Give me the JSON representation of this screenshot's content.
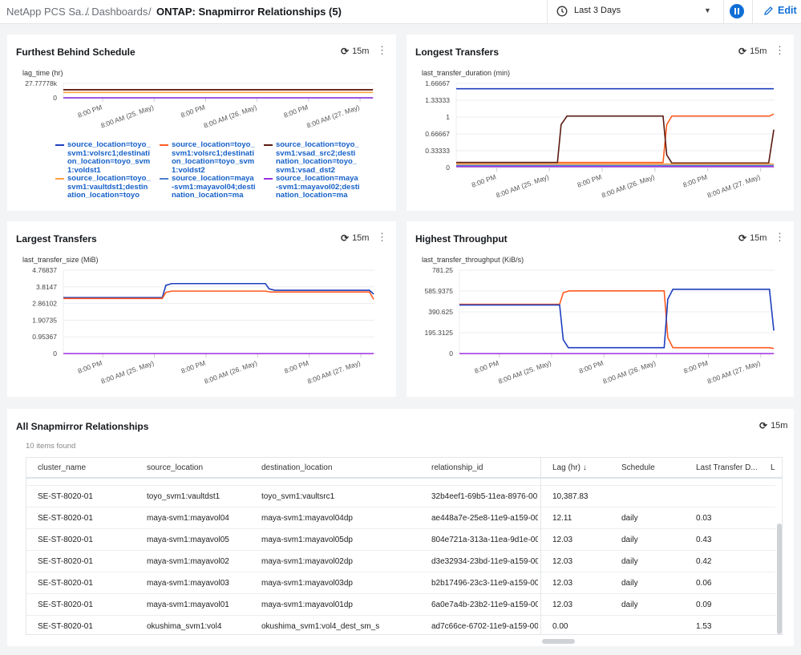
{
  "header": {
    "crumb_root": "NetApp PCS Sa...",
    "crumb_dashboards": "/ Dashboards",
    "sep": "/",
    "title": "ONTAP: Snapmirror Relationships (5)",
    "time_range": "Last 3 Days",
    "edit": "Edit",
    "accent": "#0f6fd6"
  },
  "x_axis": {
    "range": [
      "05-24 10:50",
      "05-27 11:10"
    ],
    "ticks": [
      {
        "t": "05-24 20:00",
        "label": "8:00 PM"
      },
      {
        "t": "05-25 08:00",
        "label": "8:00 AM (25. May)"
      },
      {
        "t": "05-25 20:00",
        "label": "8:00 PM"
      },
      {
        "t": "05-26 08:00",
        "label": "8:00 AM (26. May)"
      },
      {
        "t": "05-26 20:00",
        "label": "8:00 PM"
      },
      {
        "t": "05-27 08:00",
        "label": "8:00 AM (27. May)"
      }
    ]
  },
  "chart_data": [
    {
      "type": "line",
      "title": "Furthest Behind Schedule",
      "refresh": "15m",
      "ylabel": "lag_time (hr)",
      "ylim": [
        0,
        27777.78
      ],
      "y_ticks": [
        "0",
        "27.77778k"
      ],
      "y_tick_values": [
        0,
        27777.78
      ],
      "grid": true,
      "series": [
        {
          "name": "source_location=toyo_svm1:volsrc1;destination_location=toyo_svm1:voldst1",
          "color": "#1f3fbf",
          "points": [
            [
              "05-24 10:50",
              15700
            ],
            [
              "05-27 11:00",
              15700
            ]
          ]
        },
        {
          "name": "source_location=toyo_svm1:volsrc1;destination_location=toyo_svm1:voldst2",
          "color": "#ff5a1f",
          "points": [
            [
              "05-24 10:50",
              15500
            ],
            [
              "05-27 11:00",
              15500
            ]
          ]
        },
        {
          "name": "source_location=toyo_svm1:vsad_src2;destination_location=toyo_svm1:vsad_dst2",
          "color": "#5a1a10",
          "points": [
            [
              "05-24 10:50",
              15600
            ],
            [
              "05-27 11:00",
              15600
            ]
          ]
        },
        {
          "name": "source_location=toyo_svm1:vaultdst1;destination_location=toyo",
          "color": "#ffa040",
          "points": [
            [
              "05-24 10:50",
              10390
            ],
            [
              "05-27 11:00",
              10390
            ]
          ]
        },
        {
          "name": "source_location=maya-svm1:mayavol04;destination_location=ma",
          "color": "#4a7fd0",
          "points": [
            [
              "05-24 10:50",
              12
            ],
            [
              "05-27 11:00",
              12
            ]
          ]
        },
        {
          "name": "source_location=maya-svm1:mayavol02;destination_location=ma",
          "color": "#9b30e0",
          "points": [
            [
              "05-24 10:50",
              12
            ],
            [
              "05-27 11:00",
              12
            ]
          ]
        }
      ]
    },
    {
      "type": "line",
      "title": "Longest Transfers",
      "refresh": "15m",
      "ylabel": "last_transfer_duration (min)",
      "ylim": [
        0,
        1.66667
      ],
      "y_ticks": [
        "0",
        "0.33333",
        "0.66667",
        "1",
        "1.33333",
        "1.66667"
      ],
      "y_tick_values": [
        0,
        0.33333,
        0.66667,
        1,
        1.33333,
        1.66667
      ],
      "grid": true,
      "series": [
        {
          "color": "#1f3fbf",
          "points": [
            [
              "05-24 10:50",
              1.56
            ],
            [
              "05-27 11:00",
              1.56
            ]
          ]
        },
        {
          "color": "#ff5a1f",
          "points": [
            [
              "05-24 10:50",
              0.1
            ],
            [
              "05-26 09:50",
              0.1
            ],
            [
              "05-26 10:40",
              0.85
            ],
            [
              "05-26 11:50",
              1.02
            ],
            [
              "05-27 10:00",
              1.02
            ],
            [
              "05-27 11:00",
              1.06
            ]
          ]
        },
        {
          "color": "#5a1a10",
          "points": [
            [
              "05-24 10:50",
              0.1
            ],
            [
              "05-25 09:50",
              0.1
            ],
            [
              "05-25 10:40",
              0.85
            ],
            [
              "05-25 12:00",
              1.02
            ],
            [
              "05-26 09:50",
              1.02
            ],
            [
              "05-26 10:40",
              0.25
            ],
            [
              "05-26 11:50",
              0.09
            ],
            [
              "05-27 09:50",
              0.09
            ],
            [
              "05-27 11:00",
              0.75
            ]
          ]
        },
        {
          "color": "#ffa040",
          "points": [
            [
              "05-24 10:50",
              0.07
            ],
            [
              "05-27 11:00",
              0.07
            ]
          ]
        },
        {
          "color": "#4a7fd0",
          "points": [
            [
              "05-24 10:50",
              0.04
            ],
            [
              "05-27 11:00",
              0.04
            ]
          ]
        },
        {
          "color": "#9b30e0",
          "points": [
            [
              "05-24 10:50",
              0.02
            ],
            [
              "05-27 11:00",
              0.02
            ]
          ]
        }
      ]
    },
    {
      "type": "line",
      "title": "Largest Transfers",
      "refresh": "15m",
      "ylabel": "last_transfer_size (MiB)",
      "ylim": [
        0,
        4.76837
      ],
      "y_ticks": [
        "0",
        "0.95367",
        "1.90735",
        "2.86102",
        "3.8147",
        "4.76837"
      ],
      "y_tick_values": [
        0,
        0.95367,
        1.90735,
        2.86102,
        3.8147,
        4.76837
      ],
      "grid": true,
      "series": [
        {
          "color": "#9b30e0",
          "points": [
            [
              "05-24 10:50",
              0
            ],
            [
              "05-27 11:00",
              0
            ]
          ]
        },
        {
          "color": "#1f3fbf",
          "points": [
            [
              "05-24 10:50",
              3.2
            ],
            [
              "05-25 09:50",
              3.2
            ],
            [
              "05-25 10:40",
              3.9
            ],
            [
              "05-25 12:00",
              4.0
            ],
            [
              "05-26 09:50",
              4.0
            ],
            [
              "05-26 10:40",
              3.7
            ],
            [
              "05-26 12:00",
              3.62
            ],
            [
              "05-27 10:00",
              3.62
            ],
            [
              "05-27 11:00",
              3.4
            ]
          ]
        },
        {
          "color": "#ff5a1f",
          "points": [
            [
              "05-24 10:50",
              3.15
            ],
            [
              "05-25 09:50",
              3.15
            ],
            [
              "05-25 10:40",
              3.5
            ],
            [
              "05-25 12:00",
              3.57
            ],
            [
              "05-26 09:50",
              3.57
            ],
            [
              "05-26 11:00",
              3.52
            ],
            [
              "05-27 10:00",
              3.52
            ],
            [
              "05-27 11:00",
              3.1
            ]
          ]
        }
      ]
    },
    {
      "type": "line",
      "title": "Highest Throughput",
      "refresh": "15m",
      "ylabel": "last_transfer_throughput (KiB/s)",
      "ylim": [
        0,
        781.25
      ],
      "y_ticks": [
        "0",
        "195.3125",
        "390.625",
        "585.9375",
        "781.25"
      ],
      "y_tick_values": [
        0,
        195.3125,
        390.625,
        585.9375,
        781.25
      ],
      "grid": true,
      "series": [
        {
          "color": "#9b30e0",
          "points": [
            [
              "05-24 10:50",
              0
            ],
            [
              "05-27 11:00",
              0
            ]
          ]
        },
        {
          "color": "#ff5a1f",
          "points": [
            [
              "05-24 10:50",
              462
            ],
            [
              "05-25 09:50",
              462
            ],
            [
              "05-25 10:40",
              570
            ],
            [
              "05-25 12:00",
              587
            ],
            [
              "05-26 09:50",
              587
            ],
            [
              "05-26 10:40",
              150
            ],
            [
              "05-26 11:50",
              55
            ],
            [
              "05-27 10:00",
              55
            ],
            [
              "05-27 11:00",
              48
            ]
          ]
        },
        {
          "color": "#1f3fbf",
          "points": [
            [
              "05-24 10:50",
              455
            ],
            [
              "05-25 09:50",
              455
            ],
            [
              "05-25 10:40",
              130
            ],
            [
              "05-25 11:50",
              55
            ],
            [
              "05-26 09:50",
              55
            ],
            [
              "05-26 10:40",
              510
            ],
            [
              "05-26 11:50",
              602
            ],
            [
              "05-27 10:00",
              602
            ],
            [
              "05-27 11:00",
              215
            ]
          ]
        }
      ]
    }
  ],
  "table": {
    "title": "All Snapmirror Relationships",
    "refresh": "15m",
    "count": "10 items found",
    "columns": [
      "cluster_name",
      "source_location",
      "destination_location",
      "relationship_id",
      "Lag (hr) ↓",
      "Schedule",
      "Last Transfer D...",
      "L"
    ],
    "rows": [
      [
        "SE-ST-8020-01",
        "toyo_svm1:vaultdst1",
        "toyo_svm1:vaultsrc1",
        "32b4eef1-69b5-11ea-8976-00",
        "10,387.83",
        "",
        ""
      ],
      [
        "SE-ST-8020-01",
        "maya-svm1:mayavol04",
        "maya-svm1:mayavol04dp",
        "ae448a7e-25e8-11e9-a159-00",
        "12.11",
        "daily",
        "0.03"
      ],
      [
        "SE-ST-8020-01",
        "maya-svm1:mayavol05",
        "maya-svm1:mayavol05dp",
        "804e721a-313a-11ea-9d1e-00",
        "12.03",
        "daily",
        "0.43"
      ],
      [
        "SE-ST-8020-01",
        "maya-svm1:mayavol02",
        "maya-svm1:mayavol02dp",
        "d3e32934-23bd-11e9-a159-00",
        "12.03",
        "daily",
        "0.42"
      ],
      [
        "SE-ST-8020-01",
        "maya-svm1:mayavol03",
        "maya-svm1:mayavol03dp",
        "b2b17496-23c3-11e9-a159-00",
        "12.03",
        "daily",
        "0.06"
      ],
      [
        "SE-ST-8020-01",
        "maya-svm1:mayavol01",
        "maya-svm1:mayavol01dp",
        "6a0e7a4b-23b2-11e9-a159-00",
        "12.03",
        "daily",
        "0.09"
      ],
      [
        "SE-ST-8020-01",
        "okushima_svm1:vol4",
        "okushima_svm1:vol4_dest_sm_s",
        "ad7c66ce-6702-11e9-a159-00",
        "0.00",
        "",
        "1.53"
      ]
    ]
  }
}
